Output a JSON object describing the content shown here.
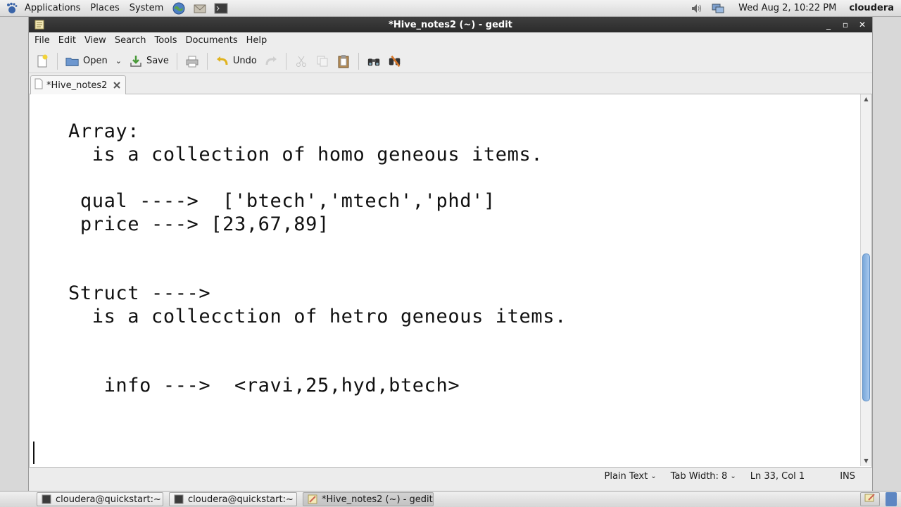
{
  "top_panel": {
    "menus": [
      "Applications",
      "Places",
      "System"
    ],
    "clock": "Wed Aug  2, 10:22 PM",
    "user": "cloudera"
  },
  "window": {
    "title": "*Hive_notes2 (~) - gedit",
    "menubar": [
      "File",
      "Edit",
      "View",
      "Search",
      "Tools",
      "Documents",
      "Help"
    ],
    "toolbar": {
      "open_label": "Open",
      "save_label": "Save",
      "undo_label": "Undo"
    },
    "tab": {
      "label": "*Hive_notes2"
    },
    "document_lines": [
      "Array:",
      "  is a collection of homo geneous items.",
      " qual ---->  ['btech','mtech','phd']",
      " price ---> [23,67,89]",
      "Struct ---->",
      "  is a collecction of hetro geneous items.",
      "   info --->  <ravi,25,hyd,btech>"
    ],
    "statusbar": {
      "language": "Plain Text",
      "tab_width": "Tab Width:  8",
      "position": "Ln 33, Col 1",
      "mode": "INS"
    }
  },
  "taskbar": {
    "tasks": [
      "cloudera@quickstart:~",
      "cloudera@quickstart:~",
      "*Hive_notes2 (~) - gedit"
    ]
  }
}
